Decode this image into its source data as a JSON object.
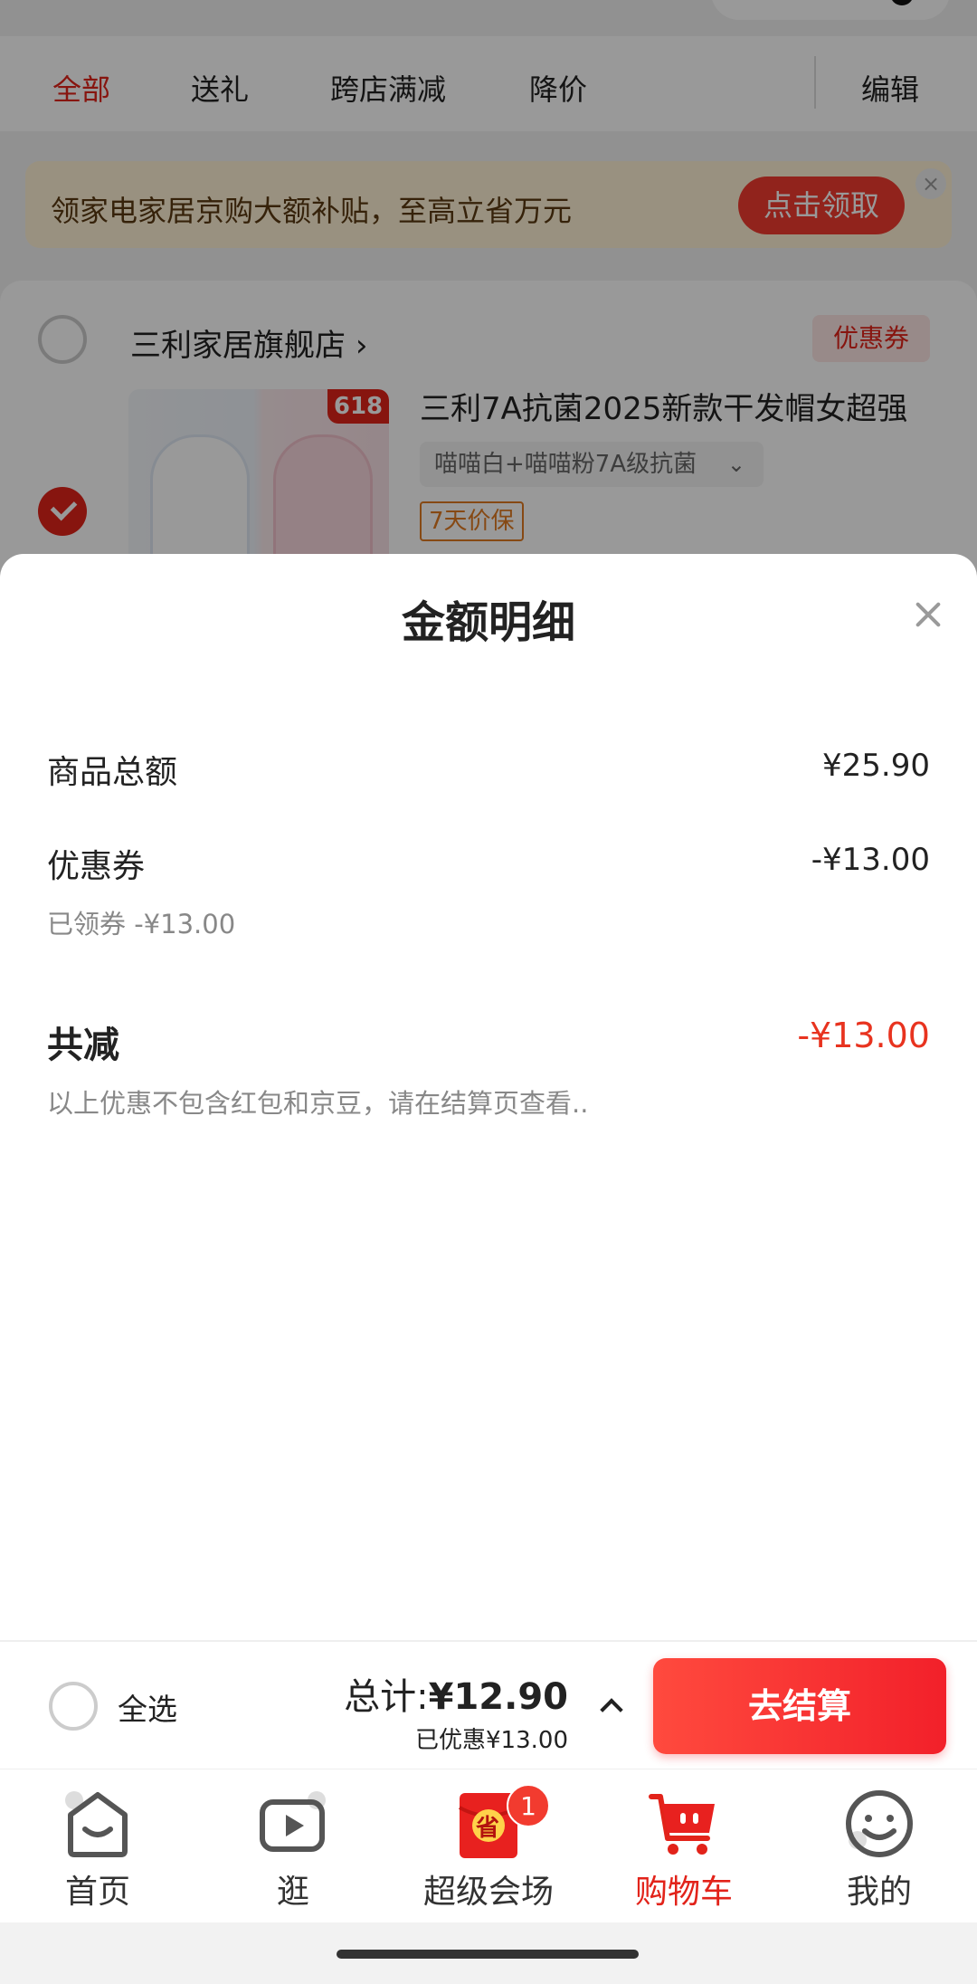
{
  "tabs": [
    {
      "label": "全部",
      "active": true
    },
    {
      "label": "送礼"
    },
    {
      "label": "跨店满减"
    },
    {
      "label": "降价"
    }
  ],
  "edit_label": "编辑",
  "banner": {
    "text": "领家电家居京购大额补贴，至高立省万元",
    "button": "点击领取",
    "close": "×"
  },
  "store": {
    "name": "三利家居旗舰店",
    "chevron": "›",
    "coupon_tag": "优惠券",
    "product": {
      "badge": "618",
      "title": "三利7A抗菌2025新款干发帽女超强",
      "spec": "喵喵白+喵喵粉7A级抗菌",
      "spec_chevron": "⌄",
      "price_protect": "7天价保"
    }
  },
  "sheet": {
    "title": "金额明细",
    "rows": {
      "goods_total_label": "商品总额",
      "goods_total_value": "¥25.90",
      "coupon_label": "优惠券",
      "coupon_value": "-¥13.00",
      "coupon_sub": "已领券 -¥13.00",
      "total_reduce_label": "共减",
      "total_reduce_value": "-¥13.00",
      "note": "以上优惠不包含红包和京豆，请在结算页查看.."
    }
  },
  "checkout": {
    "select_all": "全选",
    "total_prefix": "总计:",
    "total_amount": "¥12.90",
    "saved": "已优惠¥13.00",
    "button": "去结算"
  },
  "nav": [
    {
      "label": "首页",
      "icon": "home-icon"
    },
    {
      "label": "逛",
      "icon": "video-play-icon"
    },
    {
      "label": "超级会场",
      "icon": "red-envelope-icon",
      "badge": "1",
      "badge_text": "省"
    },
    {
      "label": "购物车",
      "icon": "cart-icon",
      "active": true
    },
    {
      "label": "我的",
      "icon": "smiley-profile-icon"
    }
  ],
  "colors": {
    "accent": "#e2231a",
    "checkout_button": "#f2202a",
    "discount_red": "#e8331f",
    "banner_bg": "#fff2d6"
  }
}
